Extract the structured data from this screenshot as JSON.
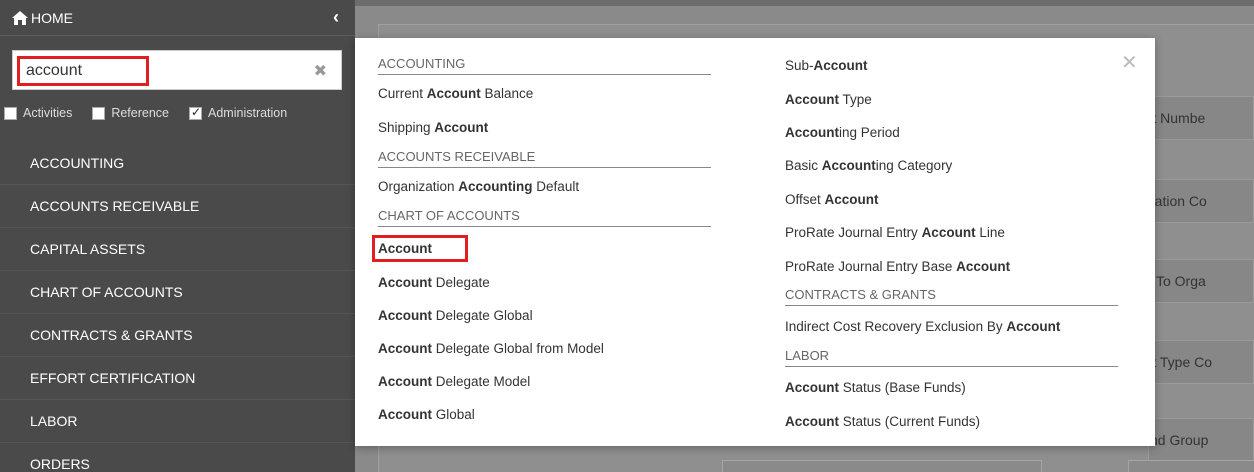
{
  "sidebar": {
    "home_label": "HOME",
    "search": {
      "value": "account"
    },
    "filters": [
      {
        "label": "Activities",
        "checked": false
      },
      {
        "label": "Reference",
        "checked": false
      },
      {
        "label": "Administration",
        "checked": true
      }
    ],
    "items": [
      {
        "label": "ACCOUNTING"
      },
      {
        "label": "ACCOUNTS RECEIVABLE"
      },
      {
        "label": "CAPITAL ASSETS"
      },
      {
        "label": "CHART OF ACCOUNTS"
      },
      {
        "label": "CONTRACTS & GRANTS"
      },
      {
        "label": "EFFORT CERTIFICATION"
      },
      {
        "label": "LABOR"
      },
      {
        "label": "ORDERS"
      }
    ]
  },
  "background": {
    "labels": [
      "ount Numbe",
      "anization Co",
      "orts To Orga",
      "ount Type Co",
      "-Fund Group"
    ]
  },
  "popup": {
    "left": {
      "sections": [
        {
          "title": "ACCOUNTING"
        },
        {
          "title": "ACCOUNTS RECEIVABLE"
        },
        {
          "title": "CHART OF ACCOUNTS"
        }
      ],
      "items": [
        {
          "pre": "Current ",
          "bold": "Account",
          "post": " Balance"
        },
        {
          "pre": "Shipping ",
          "bold": "Account",
          "post": ""
        },
        {
          "pre": "Organization ",
          "bold": "Accounting",
          "post": " Default"
        },
        {
          "pre": "",
          "bold": "Account",
          "post": ""
        },
        {
          "pre": "",
          "bold": "Account",
          "post": " Delegate"
        },
        {
          "pre": "",
          "bold": "Account",
          "post": " Delegate Global"
        },
        {
          "pre": "",
          "bold": "Account",
          "post": " Delegate Global from Model"
        },
        {
          "pre": "",
          "bold": "Account",
          "post": " Delegate Model"
        },
        {
          "pre": "",
          "bold": "Account",
          "post": " Global"
        }
      ]
    },
    "right": {
      "sections": [
        {
          "title": "CONTRACTS & GRANTS"
        },
        {
          "title": "LABOR"
        }
      ],
      "items": [
        {
          "pre": "Sub-",
          "bold": "Account",
          "post": ""
        },
        {
          "pre": "",
          "bold": "Account",
          "post": " Type"
        },
        {
          "pre": "",
          "bold": "Account",
          "post": "ing Period"
        },
        {
          "pre": "Basic ",
          "bold": "Account",
          "post": "ing Category"
        },
        {
          "pre": "Offset ",
          "bold": "Account",
          "post": ""
        },
        {
          "pre": "ProRate Journal Entry ",
          "bold": "Account",
          "post": " Line"
        },
        {
          "pre": "ProRate Journal Entry Base ",
          "bold": "Account",
          "post": ""
        },
        {
          "pre": "Indirect Cost Recovery Exclusion By ",
          "bold": "Account",
          "post": ""
        },
        {
          "pre": "",
          "bold": "Account",
          "post": " Status (Base Funds)"
        },
        {
          "pre": "",
          "bold": "Account",
          "post": " Status (Current Funds)"
        }
      ]
    }
  }
}
